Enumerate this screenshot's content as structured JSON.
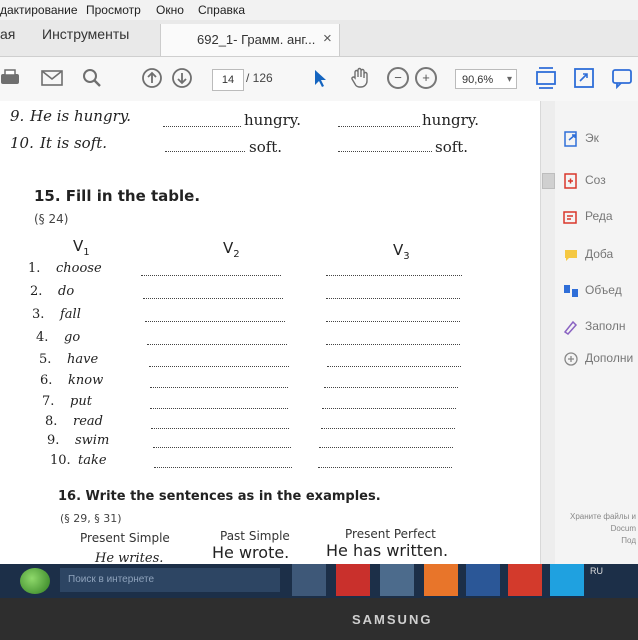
{
  "menu": {
    "items": [
      "дактирование",
      "Просмотр",
      "Окно",
      "Справка"
    ]
  },
  "tabs": {
    "left_label": "ая",
    "tools_label": "Инструменты",
    "doc_tab_label": "692_1- Грамм. анг...",
    "close_glyph": "×"
  },
  "toolbar": {
    "page_current": "14",
    "page_total": "/ 126",
    "zoom": "90,6%",
    "minus": "−",
    "plus": "+",
    "zoom_arrow": "▾"
  },
  "doc": {
    "rows_top": [
      {
        "num": "9.",
        "text": "He is hungry.",
        "a2": "hungry.",
        "a3": "hungry."
      },
      {
        "num": "10.",
        "text": "It is soft.",
        "a2": "soft.",
        "a3": "soft."
      }
    ],
    "ex15": {
      "title": "15.  Fill in the table.",
      "ref": "(§ 24)",
      "v1": "V",
      "v1_sub": "1",
      "v2": "V",
      "v2_sub": "2",
      "v3": "V",
      "v3_sub": "3",
      "verbs": [
        {
          "num": "1.",
          "verb": "choose"
        },
        {
          "num": "2.",
          "verb": "do"
        },
        {
          "num": "3.",
          "verb": "fall"
        },
        {
          "num": "4.",
          "verb": "go"
        },
        {
          "num": "5.",
          "verb": "have"
        },
        {
          "num": "6.",
          "verb": "know"
        },
        {
          "num": "7.",
          "verb": "put"
        },
        {
          "num": "8.",
          "verb": "read"
        },
        {
          "num": "9.",
          "verb": "swim"
        },
        {
          "num": "10.",
          "verb": "take"
        }
      ]
    },
    "ex16": {
      "title": "16.  Write the sentences as in the examples.",
      "ref": "(§ 29, § 31)",
      "col1": "Present Simple",
      "col2": "Past Simple",
      "col3": "Present Perfect",
      "ex1": "He writes.",
      "ex2": "He wrote.",
      "ex3": "He has written."
    }
  },
  "right_panel": {
    "items": [
      "Эк",
      "Соз",
      "Реда",
      "Доба",
      "Объед",
      "Заполн",
      "Дополни"
    ],
    "promo_line1": "Храните файлы и",
    "promo_line2": "Docum",
    "promo_line3": "Под"
  },
  "taskbar": {
    "search_placeholder": "Поиск в интернете",
    "lang": "RU"
  },
  "monitor": {
    "brand": "SAMSUNG"
  },
  "colors": {
    "accent_blue": "#2f6ed8",
    "export_red": "#d9362b",
    "cursor_blue": "#1565c0"
  }
}
